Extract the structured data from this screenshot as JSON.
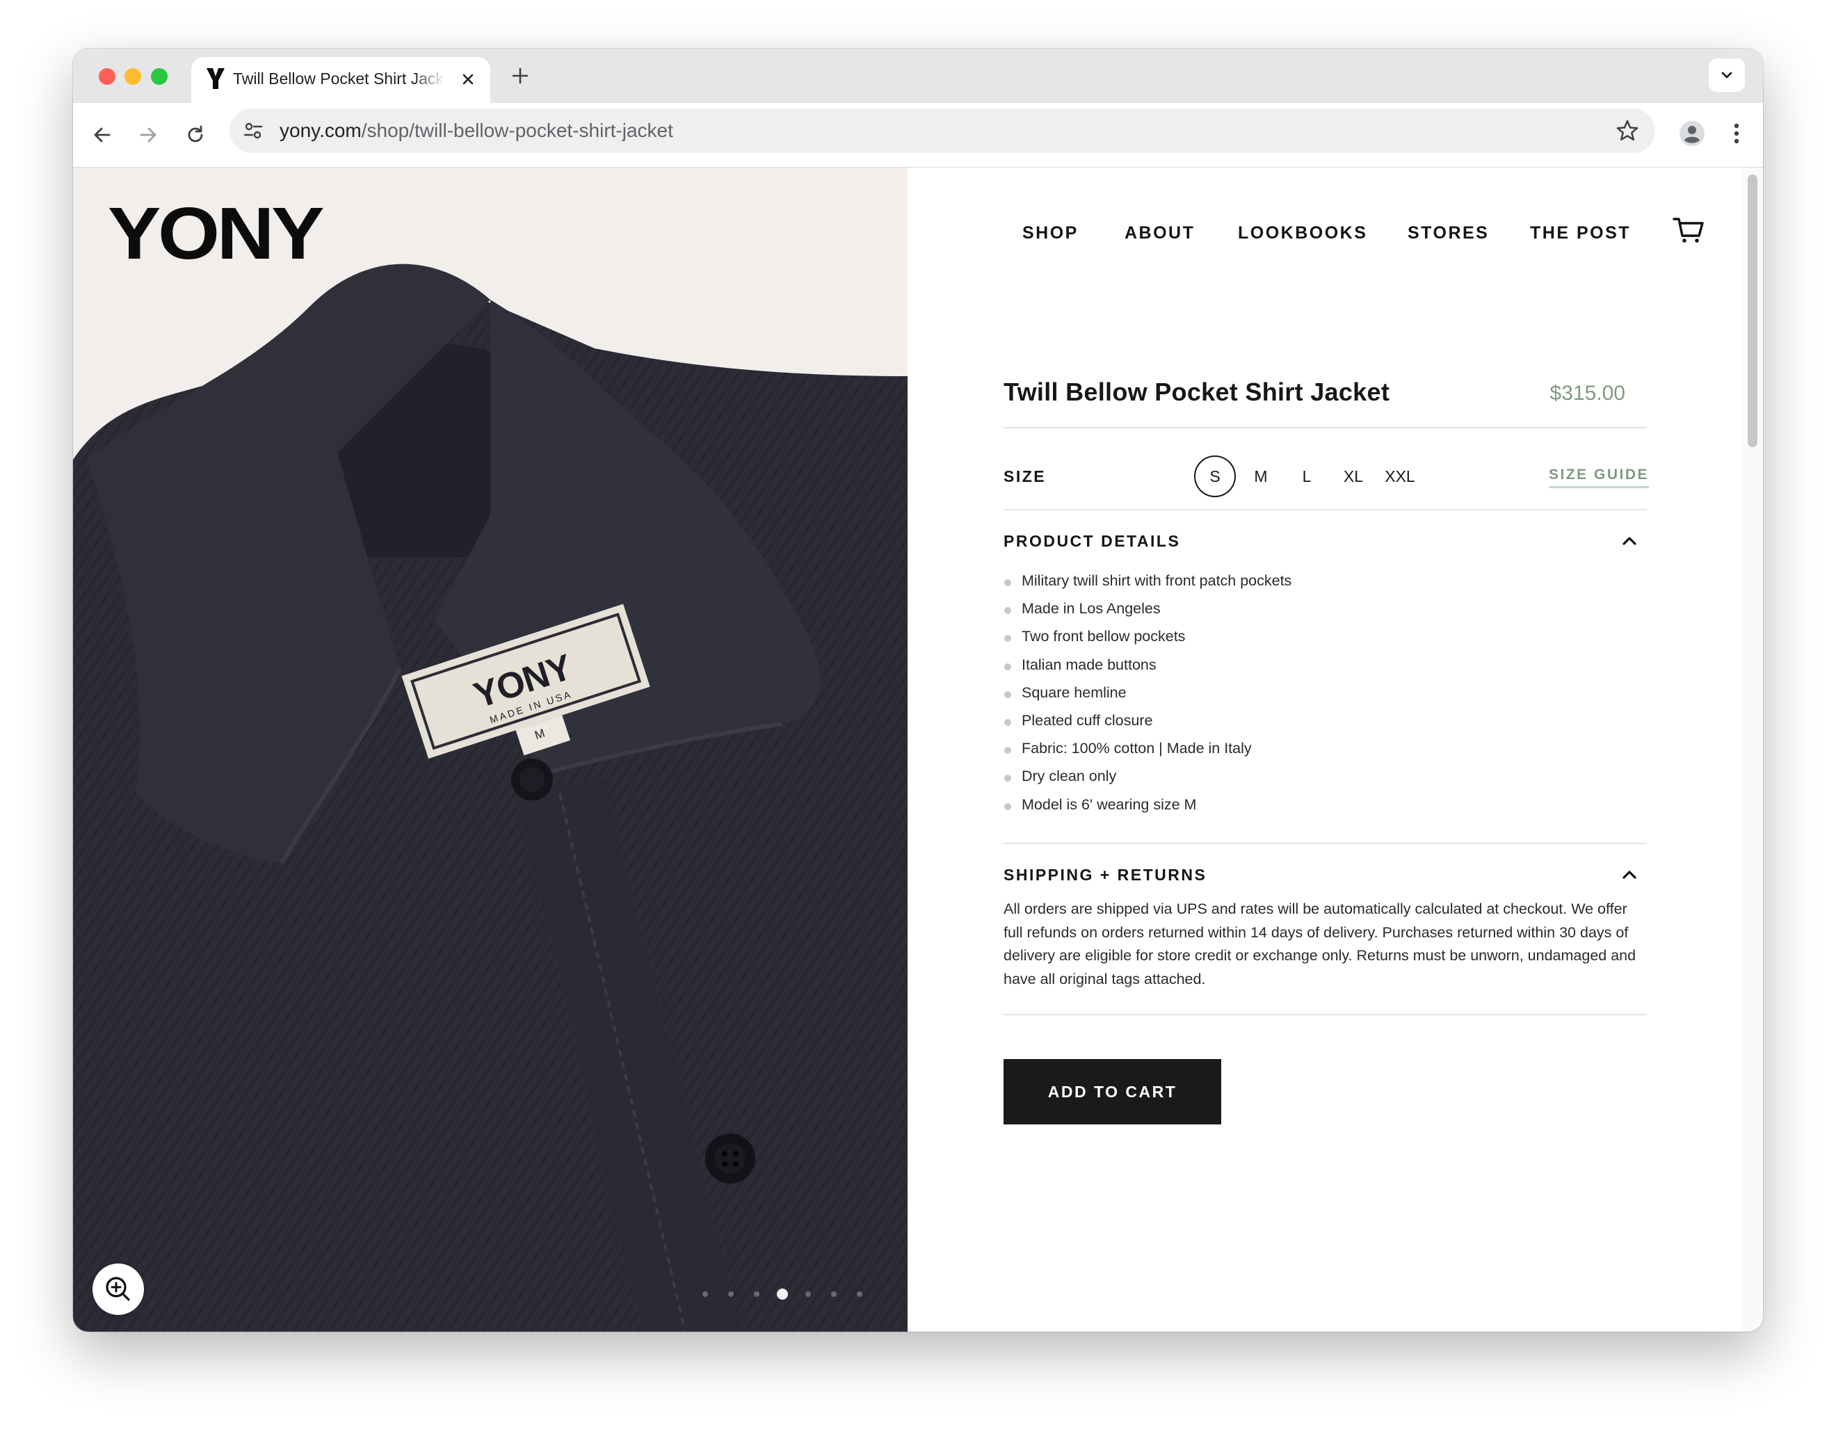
{
  "browser": {
    "tab_title": "Twill Bellow Pocket Shirt Jacket",
    "url_host": "yony.com",
    "url_path": "/shop/twill-bellow-pocket-shirt-jacket"
  },
  "site": {
    "logo": "YONY",
    "nav": [
      "SHOP",
      "ABOUT",
      "LOOKBOOKS",
      "STORES",
      "THE POST"
    ]
  },
  "image_carousel": {
    "label_text": "YONY",
    "label_subtext": "MADE IN USA",
    "size_tag": "M",
    "slide_count": 7,
    "active_slide": 4
  },
  "product": {
    "title": "Twill Bellow Pocket Shirt Jacket",
    "price": "$315.00",
    "size_label": "SIZE",
    "sizes": [
      "S",
      "M",
      "L",
      "XL",
      "XXL"
    ],
    "selected_size": "S",
    "size_guide": "SIZE GUIDE",
    "details_heading": "PRODUCT DETAILS",
    "details": [
      "Military twill shirt with front patch pockets",
      "Made in Los Angeles",
      "Two front bellow pockets",
      "Italian made buttons",
      "Square hemline",
      "Pleated cuff closure",
      "Fabric: 100% cotton  |  Made in Italy",
      "Dry clean only",
      "Model is 6' wearing size M"
    ],
    "shipping_heading": "SHIPPING + RETURNS",
    "shipping_text": "All orders are shipped via UPS and rates will be automatically calculated at checkout. We offer full refunds on orders returned within 14 days of delivery. Purchases returned within 30 days of delivery are eligible for store credit or exchange only. Returns must be unworn, undamaged and have all original tags attached.",
    "add_to_cart": "ADD TO CART"
  },
  "colors": {
    "accent_green": "#7f9b81",
    "button_black": "#1a1a1a",
    "shirt_navy": "#2b2c35",
    "photo_bg": "#f2eeeb"
  }
}
